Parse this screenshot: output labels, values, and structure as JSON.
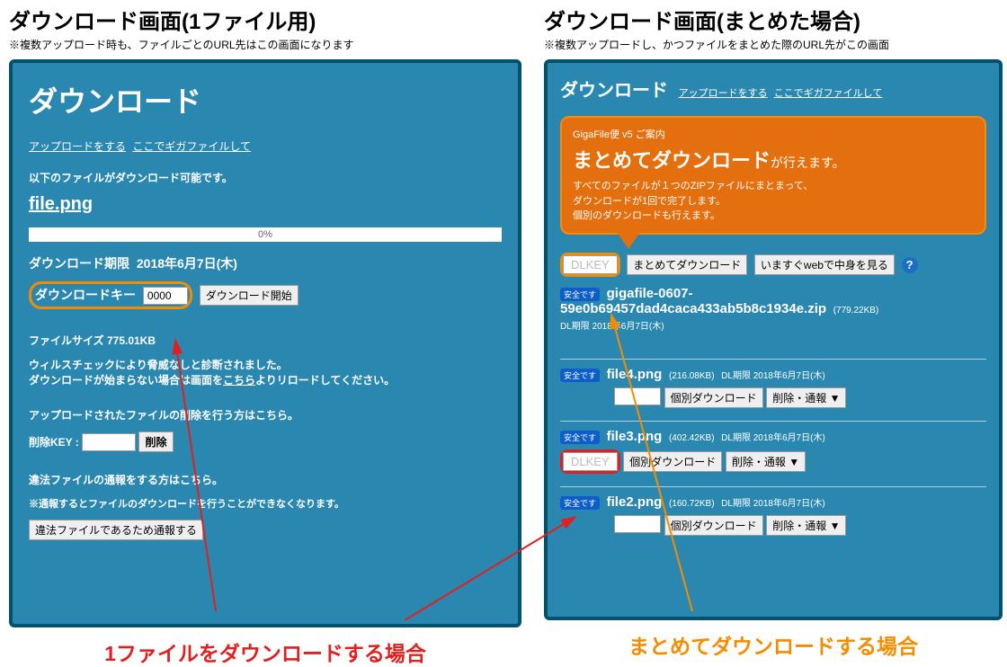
{
  "left": {
    "title": "ダウンロード画面(1ファイル用)",
    "subtitle": "※複数アップロード時も、ファイルごとのURL先はこの画面になります",
    "h1": "ダウンロード",
    "link_upload": "アップロードをする",
    "link_giga": "ここでギガファイルして",
    "msg_available": "以下のファイルがダウンロード可能です。",
    "filename": "file.png",
    "progress": "0%",
    "deadline_label": "ダウンロード期限",
    "deadline_value": "2018年6月7日(木)",
    "key_label": "ダウンロードキー",
    "key_value": "0000",
    "btn_start": "ダウンロード開始",
    "filesize": "ファイルサイズ 775.01KB",
    "virus": "ウィルスチェックにより脅威なしと診断されました。",
    "reload_pre": "ダウンロードが始まらない場合は画面を",
    "reload_link": "こちら",
    "reload_post": "よりリロードしてください。",
    "delete_msg": "アップロードされたファイルの削除を行う方はこちら。",
    "delete_key_label": "削除KEY :",
    "btn_delete": "削除",
    "report_msg": "違法ファイルの通報をする方はこちら。",
    "report_note": "※通報するとファイルのダウンロードを行うことができなくなります。",
    "btn_report": "違法ファイルであるため通報する",
    "caption": "1ファイルをダウンロードする場合"
  },
  "right": {
    "title": "ダウンロード画面(まとめた場合)",
    "subtitle": "※複数アップロードし、かつファイルをまとめた際のURL先がこの画面",
    "h1": "ダウンロード",
    "link_upload": "アップロードをする",
    "link_giga": "ここでギガファイルして",
    "assist_small": "GigaFile便 v5 ご案内",
    "assist_big": "まとめてダウンロード",
    "assist_big_suffix": "が行えます。",
    "assist_desc1": "すべてのファイルが１つのZIPファイルにまとまって、",
    "assist_desc2": "ダウンロードが1回で完了します。",
    "assist_desc3": "個別のダウンロードも行えます。",
    "dlkey_placeholder": "DLKEY",
    "btn_bulk": "まとめてダウンロード",
    "btn_web": "いますぐwebで中身を見る",
    "safe_badge": "安全です",
    "zipname": "gigafile-0607-59e0b​69457dad4caca433ab5b8c1934e.zip",
    "zipsize": "(779.22KB)",
    "zipdeadline": "DL期限 2018年6月7日(木)",
    "files": [
      {
        "name": "file4.png",
        "size": "(216.08KB)",
        "deadline": "DL期限 2018年6月7日(木)"
      },
      {
        "name": "file3.png",
        "size": "(402.42KB)",
        "deadline": "DL期限 2018年6月7日(木)"
      },
      {
        "name": "file2.png",
        "size": "(160.72KB)",
        "deadline": "DL期限 2018年6月7日(木)"
      }
    ],
    "btn_indiv": "個別ダウンロード",
    "btn_delrep": "削除・通報 ▼",
    "caption": "まとめてダウンロードする場合"
  }
}
